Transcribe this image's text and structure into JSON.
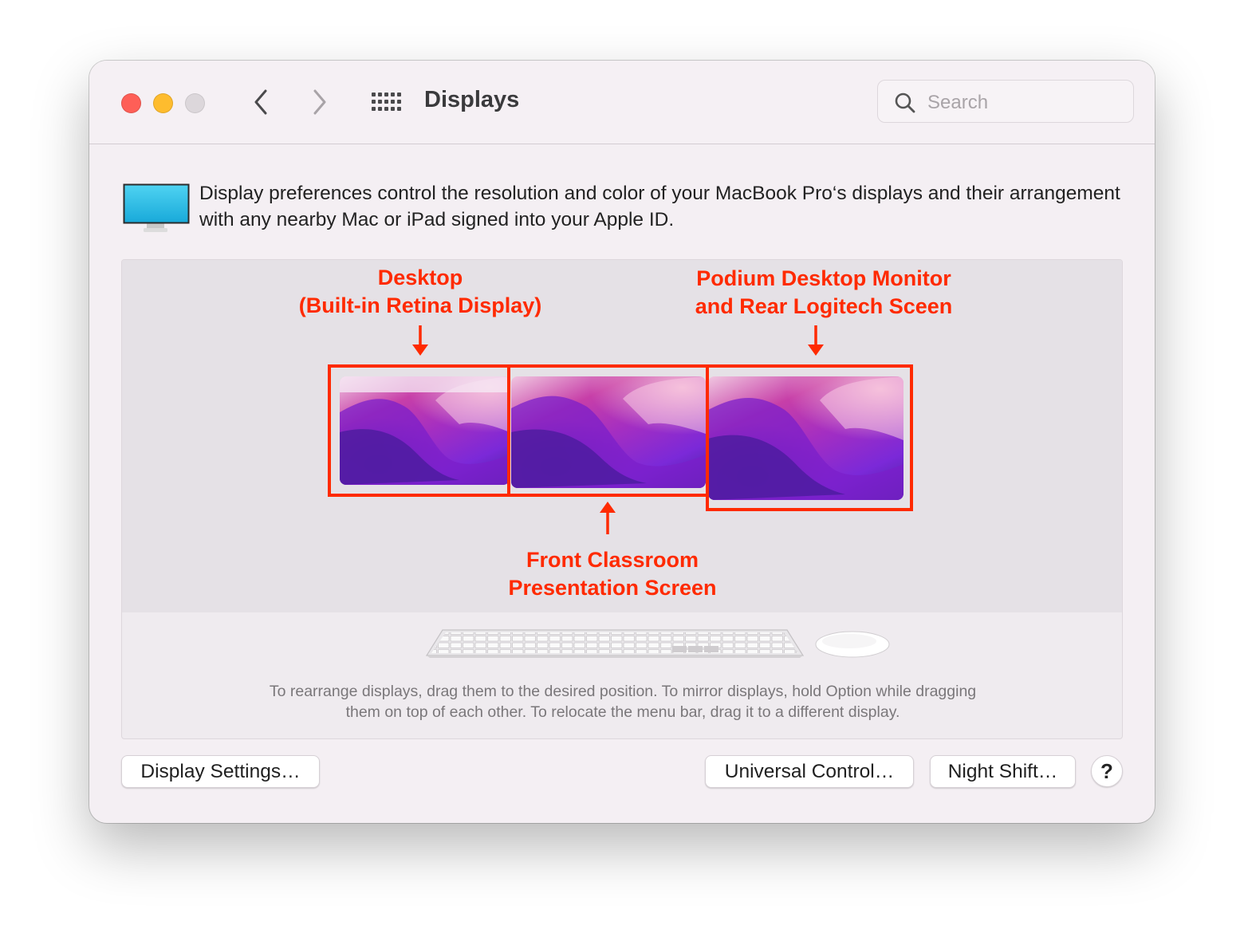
{
  "window": {
    "title": "Displays",
    "search": {
      "placeholder": "Search",
      "value": ""
    }
  },
  "intro": {
    "icon": "display-icon",
    "text": "Display preferences control the resolution and color of your MacBook Pro‘s displays and their arrangement with any nearby Mac or iPad signed into your Apple ID."
  },
  "arrangement": {
    "displays": [
      "desktop-display",
      "front-classroom-display",
      "podium-logitech-display"
    ],
    "annotations": {
      "desktop": {
        "line1": "Desktop",
        "line2": "(Built-in Retina Display)"
      },
      "podium": {
        "line1": "Podium Desktop Monitor",
        "line2": "and Rear Logitech Sceen"
      },
      "front": {
        "line1": "Front Classroom",
        "line2": "Presentation Screen"
      }
    },
    "annotation_color": "#ff2a00",
    "help_line1": "To rearrange displays, drag them to the desired position. To mirror displays, hold Option while dragging",
    "help_line2": "them on top of each other. To relocate the menu bar, drag it to a different display."
  },
  "buttons": {
    "display_settings": "Display Settings…",
    "universal_control": "Universal Control…",
    "night_shift": "Night Shift…",
    "help": "?"
  },
  "colors": {
    "close": "#fe5f57",
    "minimize": "#febc2e",
    "zoom_disabled": "#dcd7db"
  }
}
